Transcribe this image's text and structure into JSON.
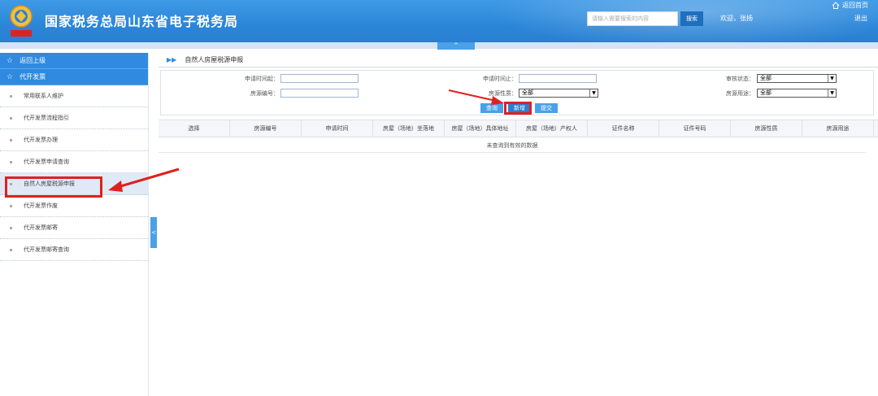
{
  "header": {
    "title": "国家税务总局山东省电子税务局",
    "logo_text": "中国税务",
    "search_placeholder": "请输入需要搜索的内容",
    "search_label": "搜索",
    "welcome": "欢迎，张扬",
    "home_label": "返回首页",
    "logout_label": "退出"
  },
  "collapse_label": "^",
  "sidebar": {
    "back": "返回上级",
    "section": "代开发票",
    "items": [
      {
        "label": "常用联系人维护"
      },
      {
        "label": "代开发票流程指引"
      },
      {
        "label": "代开发票办理"
      },
      {
        "label": "代开发票申请查询"
      },
      {
        "label": "自然人房屋税源申报"
      },
      {
        "label": "代开发票作废"
      },
      {
        "label": "代开发票邮寄"
      },
      {
        "label": "代开发票邮寄查询"
      }
    ],
    "active_index": 4,
    "toggle": "<"
  },
  "main": {
    "page_title": "自然人房屋税源申报",
    "form": {
      "apply_start_label": "申请时间起：",
      "apply_end_label": "申请时间止：",
      "review_status_label": "审核状态：",
      "review_status_value": "全部",
      "source_no_label": "房源编号：",
      "source_nature_label": "房源性质：",
      "source_nature_value": "全部",
      "source_use_label": "房源用途：",
      "source_use_value": "全部",
      "query_button": "查询",
      "add_button": "新增",
      "submit_button": "提交"
    },
    "table": {
      "columns": [
        "选择",
        "房源编号",
        "申请时间",
        "房屋（场地）坐落地",
        "房屋（场地）具体地址",
        "房屋（场地）产权人",
        "证件名称",
        "证件号码",
        "房源性质",
        "房源用途"
      ],
      "empty_text": "未查询到有效的数据"
    }
  },
  "colors": {
    "brand_blue": "#2b86d8",
    "annotation_red": "#e02020"
  }
}
